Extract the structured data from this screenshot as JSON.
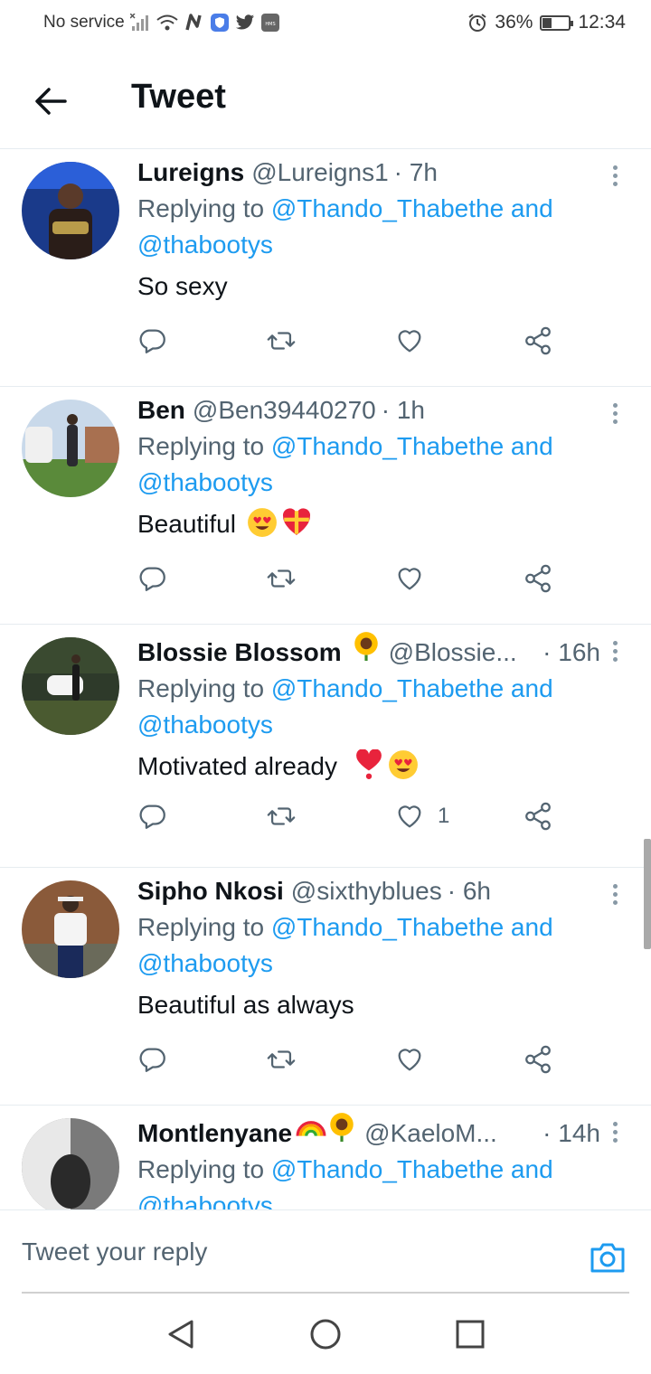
{
  "status_bar": {
    "carrier": "No service",
    "battery": "36%",
    "battery_level": 0.36,
    "time": "12:34",
    "icons": [
      "signal-off-icon",
      "wifi-icon",
      "n-icon",
      "shield-icon",
      "twitter-bird-icon",
      "hms-icon",
      "alarm-icon",
      "battery-icon"
    ]
  },
  "header": {
    "title": "Tweet",
    "back_icon": "arrow-left-icon"
  },
  "tweets": [
    {
      "name": "Lureigns",
      "handle": "@Lureigns1",
      "time": "· 7h",
      "replying_prefix": "Replying to ",
      "replying_to_1": "@Thando_Thabethe and",
      "replying_to_2": "@thabootys",
      "text": "So sexy",
      "emojis": [],
      "likes": ""
    },
    {
      "name": "Ben",
      "handle": "@Ben39440270",
      "time": "· 1h",
      "replying_prefix": "Replying to ",
      "replying_to_1": "@Thando_Thabethe and",
      "replying_to_2": "@thabootys",
      "text": "Beautiful",
      "emojis": [
        "heart-eyes",
        "gift-heart"
      ],
      "likes": ""
    },
    {
      "name": "Blossie Blossom",
      "name_emoji": "sunflower",
      "handle": "@Blossie...",
      "time": "· 16h",
      "replying_prefix": "Replying to ",
      "replying_to_1": "@Thando_Thabethe and",
      "replying_to_2": "@thabootys",
      "text": "Motivated already",
      "emojis": [
        "red-heart",
        "heart-eyes"
      ],
      "likes": "1"
    },
    {
      "name": "Sipho Nkosi",
      "handle": "@sixthyblues",
      "time": "· 6h",
      "replying_prefix": "Replying to ",
      "replying_to_1": "@Thando_Thabethe and",
      "replying_to_2": "@thabootys",
      "text": "Beautiful as always",
      "emojis": [],
      "likes": ""
    },
    {
      "name": "Montlenyane",
      "name_emoji": "rainbow-sunflower",
      "handle": "@KaeloM...",
      "time": "· 14h",
      "replying_prefix": "Replying to ",
      "replying_to_1": "@Thando_Thabethe and",
      "replying_to_2": "@thabootys",
      "text": "",
      "emojis": [],
      "likes": ""
    }
  ],
  "reply_bar": {
    "placeholder": "Tweet your reply",
    "camera_icon": "camera-icon"
  },
  "nav_bar": {
    "icons": [
      "nav-back-icon",
      "nav-home-icon",
      "nav-recent-icon"
    ]
  },
  "colors": {
    "link": "#1d9bf0",
    "secondary_text": "#536471",
    "divider": "#e6ecf0"
  }
}
